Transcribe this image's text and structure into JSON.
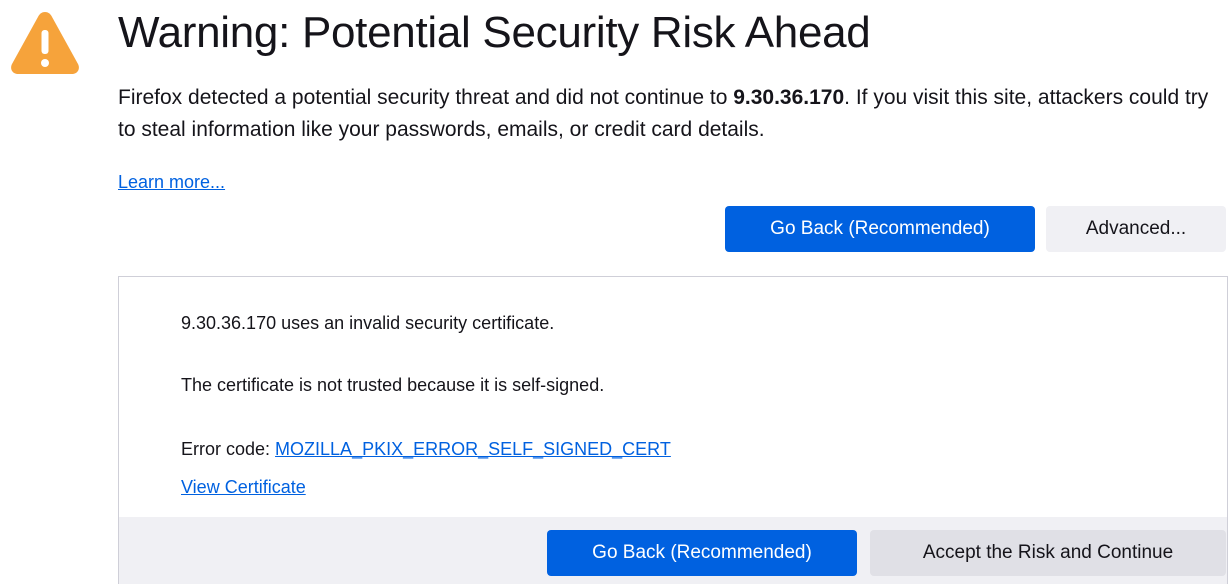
{
  "header": {
    "title": "Warning: Potential Security Risk Ahead",
    "warning_color": "#f6a33b"
  },
  "description": {
    "prefix": "Firefox detected a potential security threat and did not continue to ",
    "host": "9.30.36.170",
    "suffix": ". If you visit this site, attackers could try to steal information like your passwords, emails, or credit card details."
  },
  "links": {
    "learn_more": "Learn more..."
  },
  "buttons": {
    "go_back": "Go Back (Recommended)",
    "advanced": "Advanced...",
    "accept_risk": "Accept the Risk and Continue"
  },
  "advanced_panel": {
    "line1": "9.30.36.170 uses an invalid security certificate.",
    "line2": "The certificate is not trusted because it is self-signed.",
    "error_label": "Error code: ",
    "error_code": "MOZILLA_PKIX_ERROR_SELF_SIGNED_CERT",
    "view_certificate": "View Certificate"
  },
  "colors": {
    "primary": "#0061e0",
    "secondary_bg": "#f0f0f4",
    "text": "#15141a"
  }
}
